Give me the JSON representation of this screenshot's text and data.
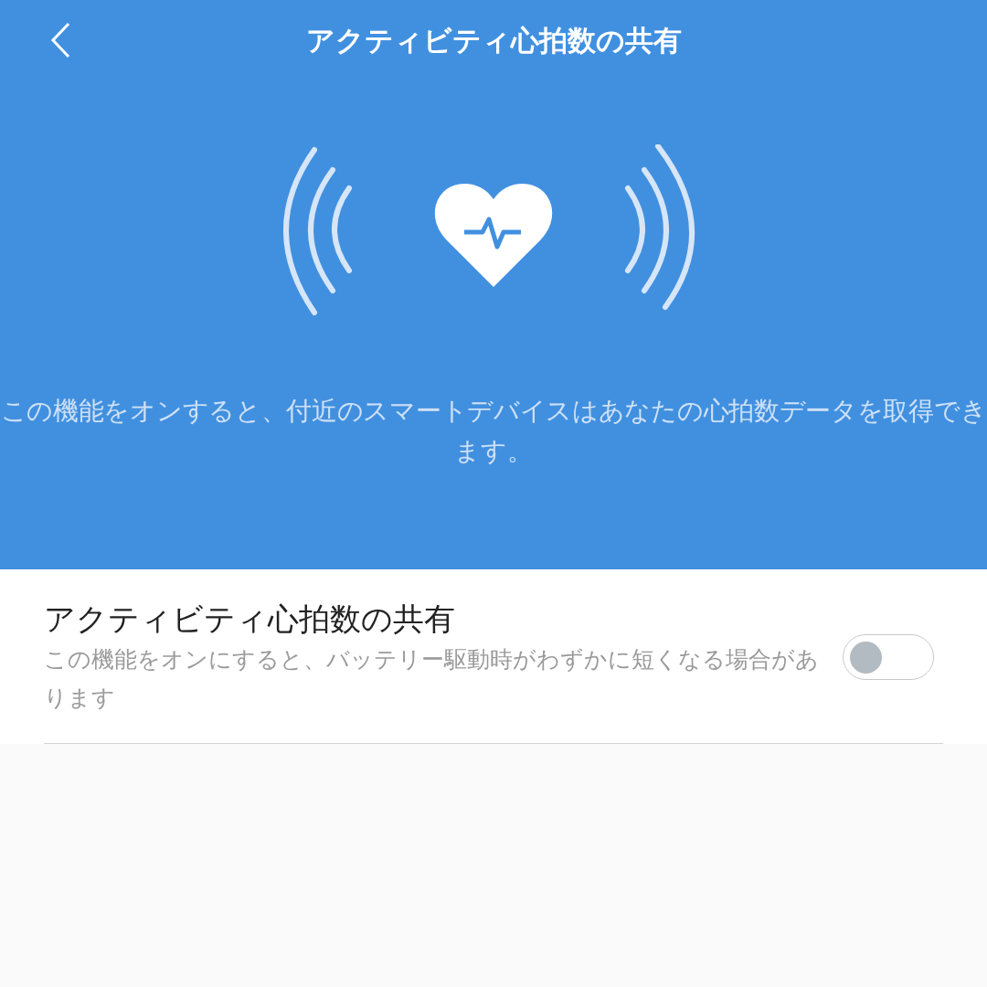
{
  "header": {
    "title": "アクティビティ心拍数の共有"
  },
  "description": "この機能をオンすると、付近のスマートデバイスはあなたの心拍数データを取得できます。",
  "setting": {
    "title": "アクティビティ心拍数の共有",
    "subtitle": "この機能をオンにすると、バッテリー駆動時がわずかに短くなる場合があります",
    "on": false
  }
}
